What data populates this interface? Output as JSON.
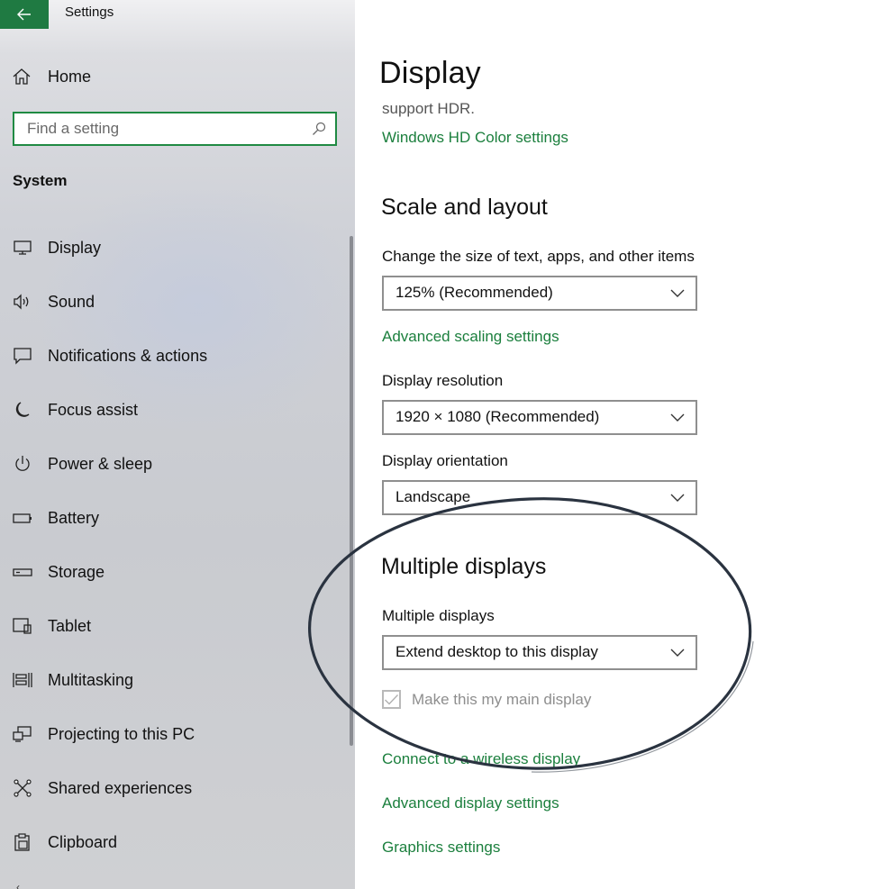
{
  "window": {
    "title": "Settings"
  },
  "sidebar": {
    "home_label": "Home",
    "search_placeholder": "Find a setting",
    "section_title": "System",
    "items": [
      {
        "label": "Display",
        "icon": "monitor-icon"
      },
      {
        "label": "Sound",
        "icon": "speaker-icon"
      },
      {
        "label": "Notifications & actions",
        "icon": "notification-icon"
      },
      {
        "label": "Focus assist",
        "icon": "moon-icon"
      },
      {
        "label": "Power & sleep",
        "icon": "power-icon"
      },
      {
        "label": "Battery",
        "icon": "battery-icon"
      },
      {
        "label": "Storage",
        "icon": "storage-icon"
      },
      {
        "label": "Tablet",
        "icon": "tablet-icon"
      },
      {
        "label": "Multitasking",
        "icon": "multitasking-icon"
      },
      {
        "label": "Projecting to this PC",
        "icon": "projecting-icon"
      },
      {
        "label": "Shared experiences",
        "icon": "shared-experiences-icon"
      },
      {
        "label": "Clipboard",
        "icon": "clipboard-icon"
      }
    ]
  },
  "main": {
    "page_title": "Display",
    "hdr_text": "support HDR.",
    "hd_color_link": "Windows HD Color settings",
    "scale_section": {
      "heading": "Scale and layout",
      "size_label": "Change the size of text, apps, and other items",
      "size_value": "125% (Recommended)",
      "advanced_scaling_link": "Advanced scaling settings",
      "resolution_label": "Display resolution",
      "resolution_value": "1920 × 1080 (Recommended)",
      "orientation_label": "Display orientation",
      "orientation_value": "Landscape"
    },
    "multiple_section": {
      "heading": "Multiple displays",
      "dropdown_label": "Multiple displays",
      "dropdown_value": "Extend desktop to this display",
      "main_display_checkbox": "Make this my main display",
      "main_display_checked": true
    },
    "links": {
      "wireless": "Connect to a wireless display",
      "advanced_display": "Advanced display settings",
      "graphics": "Graphics settings"
    }
  },
  "colors": {
    "accent": "#1f7a42",
    "link": "#1b7f3d",
    "annotation_ellipse": "#2a3340"
  }
}
